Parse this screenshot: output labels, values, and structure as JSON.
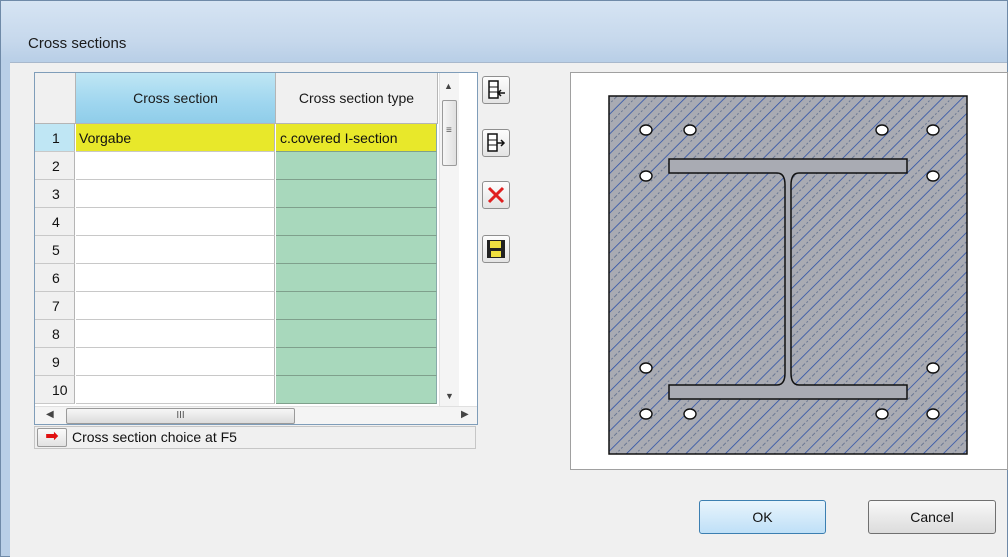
{
  "window": {
    "title": "Cross sections"
  },
  "grid": {
    "columns": [
      "Cross section",
      "Cross section type"
    ],
    "rows": [
      {
        "num": "1",
        "name": "Vorgabe",
        "type": "c.covered I-section"
      },
      {
        "num": "2",
        "name": "",
        "type": ""
      },
      {
        "num": "3",
        "name": "",
        "type": ""
      },
      {
        "num": "4",
        "name": "",
        "type": ""
      },
      {
        "num": "5",
        "name": "",
        "type": ""
      },
      {
        "num": "6",
        "name": "",
        "type": ""
      },
      {
        "num": "7",
        "name": "",
        "type": ""
      },
      {
        "num": "8",
        "name": "",
        "type": ""
      },
      {
        "num": "9",
        "name": "",
        "type": ""
      },
      {
        "num": "10",
        "name": "",
        "type": ""
      }
    ]
  },
  "status": {
    "text": "Cross section choice at F5"
  },
  "toolbar": {
    "items": [
      "insert-row-icon",
      "append-row-icon",
      "delete-icon",
      "save-icon"
    ]
  },
  "buttons": {
    "ok": "OK",
    "cancel": "Cancel"
  },
  "colors": {
    "selected_row": "#e8e82a",
    "type_cells": "#a8d8bc",
    "header_selected": "#9fd6ef",
    "concrete": "#a9abb3",
    "hatch": "#2c50a6"
  }
}
